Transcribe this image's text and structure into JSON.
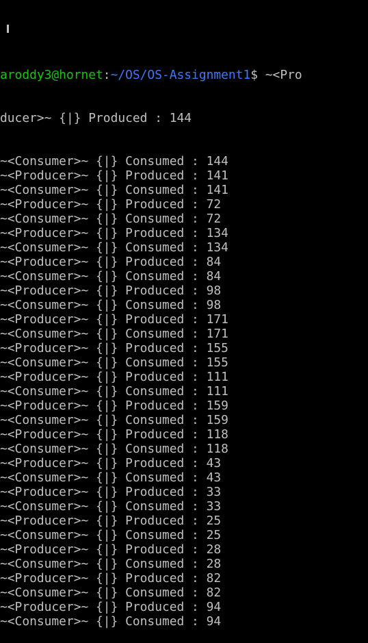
{
  "terminal": {
    "partial_top": "{|}",
    "prompt": {
      "user_host": "aroddy3@hornet",
      "separator": ":",
      "path": "~/OS/OS-Assignment1",
      "symbol": "$",
      "input_start": " ~<Pro"
    },
    "continuation": "ducer>~ {|} Produced : 144",
    "lines": [
      "~<Consumer>~ {|} Consumed : 144",
      "~<Producer>~ {|} Produced : 141",
      "~<Consumer>~ {|} Consumed : 141",
      "~<Producer>~ {|} Produced : 72",
      "~<Consumer>~ {|} Consumed : 72",
      "~<Producer>~ {|} Produced : 134",
      "~<Consumer>~ {|} Consumed : 134",
      "~<Producer>~ {|} Produced : 84",
      "~<Consumer>~ {|} Consumed : 84",
      "~<Producer>~ {|} Produced : 98",
      "~<Consumer>~ {|} Consumed : 98",
      "~<Producer>~ {|} Produced : 171",
      "~<Consumer>~ {|} Consumed : 171",
      "~<Producer>~ {|} Produced : 155",
      "~<Consumer>~ {|} Consumed : 155",
      "~<Producer>~ {|} Produced : 111",
      "~<Consumer>~ {|} Consumed : 111",
      "~<Producer>~ {|} Produced : 159",
      "~<Consumer>~ {|} Consumed : 159",
      "~<Producer>~ {|} Produced : 118",
      "~<Consumer>~ {|} Consumed : 118",
      "~<Producer>~ {|} Produced : 43",
      "~<Consumer>~ {|} Consumed : 43",
      "~<Producer>~ {|} Produced : 33",
      "~<Consumer>~ {|} Consumed : 33",
      "~<Producer>~ {|} Produced : 25",
      "~<Consumer>~ {|} Consumed : 25",
      "~<Producer>~ {|} Produced : 28",
      "~<Consumer>~ {|} Consumed : 28",
      "~<Producer>~ {|} Produced : 82",
      "~<Consumer>~ {|} Consumed : 82",
      "~<Producer>~ {|} Produced : 94",
      "~<Consumer>~ {|} Consumed : 94"
    ]
  },
  "colors": {
    "background": "#000000",
    "text": "#c0c0c0",
    "user_host": "#16c60c",
    "path": "#3b78ff"
  }
}
